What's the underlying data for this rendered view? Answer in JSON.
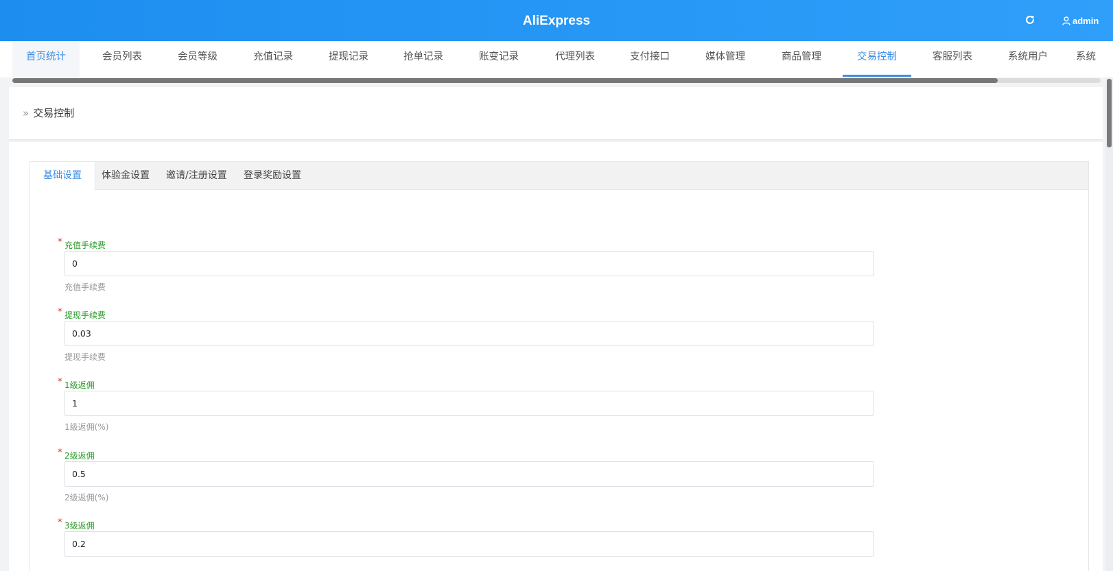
{
  "header": {
    "app_title": "AliExpress",
    "user_name": "admin"
  },
  "nav": {
    "tabs": [
      "首页统计",
      "会员列表",
      "会员等级",
      "充值记录",
      "提现记录",
      "抢单记录",
      "账变记录",
      "代理列表",
      "支付接口",
      "媒体管理",
      "商品管理",
      "交易控制",
      "客服列表",
      "系统用户",
      "系统"
    ],
    "active": "交易控制"
  },
  "breadcrumb": {
    "current": "交易控制"
  },
  "tabs": {
    "items": [
      "基础设置",
      "体验金设置",
      "邀请/注册设置",
      "登录奖励设置"
    ],
    "active": "基础设置"
  },
  "form": {
    "fields": [
      {
        "label": "充值手续费",
        "value": "0",
        "hint": "充值手续费"
      },
      {
        "label": "提现手续费",
        "value": "0.03",
        "hint": "提现手续费"
      },
      {
        "label": "1级返佣",
        "value": "1",
        "hint": "1级返佣(%)"
      },
      {
        "label": "2级返佣",
        "value": "0.5",
        "hint": "2级返佣(%)"
      },
      {
        "label": "3级返佣",
        "value": "0.2",
        "hint": ""
      }
    ]
  },
  "colors": {
    "header": "#1d8ef0",
    "accent": "#3a8ee6",
    "label_green": "#2a9a2a",
    "required_red": "#e02020"
  },
  "icons": {
    "refresh": "refresh-icon",
    "user": "user-icon",
    "breadcrumb": "double-chevron-right-icon"
  }
}
